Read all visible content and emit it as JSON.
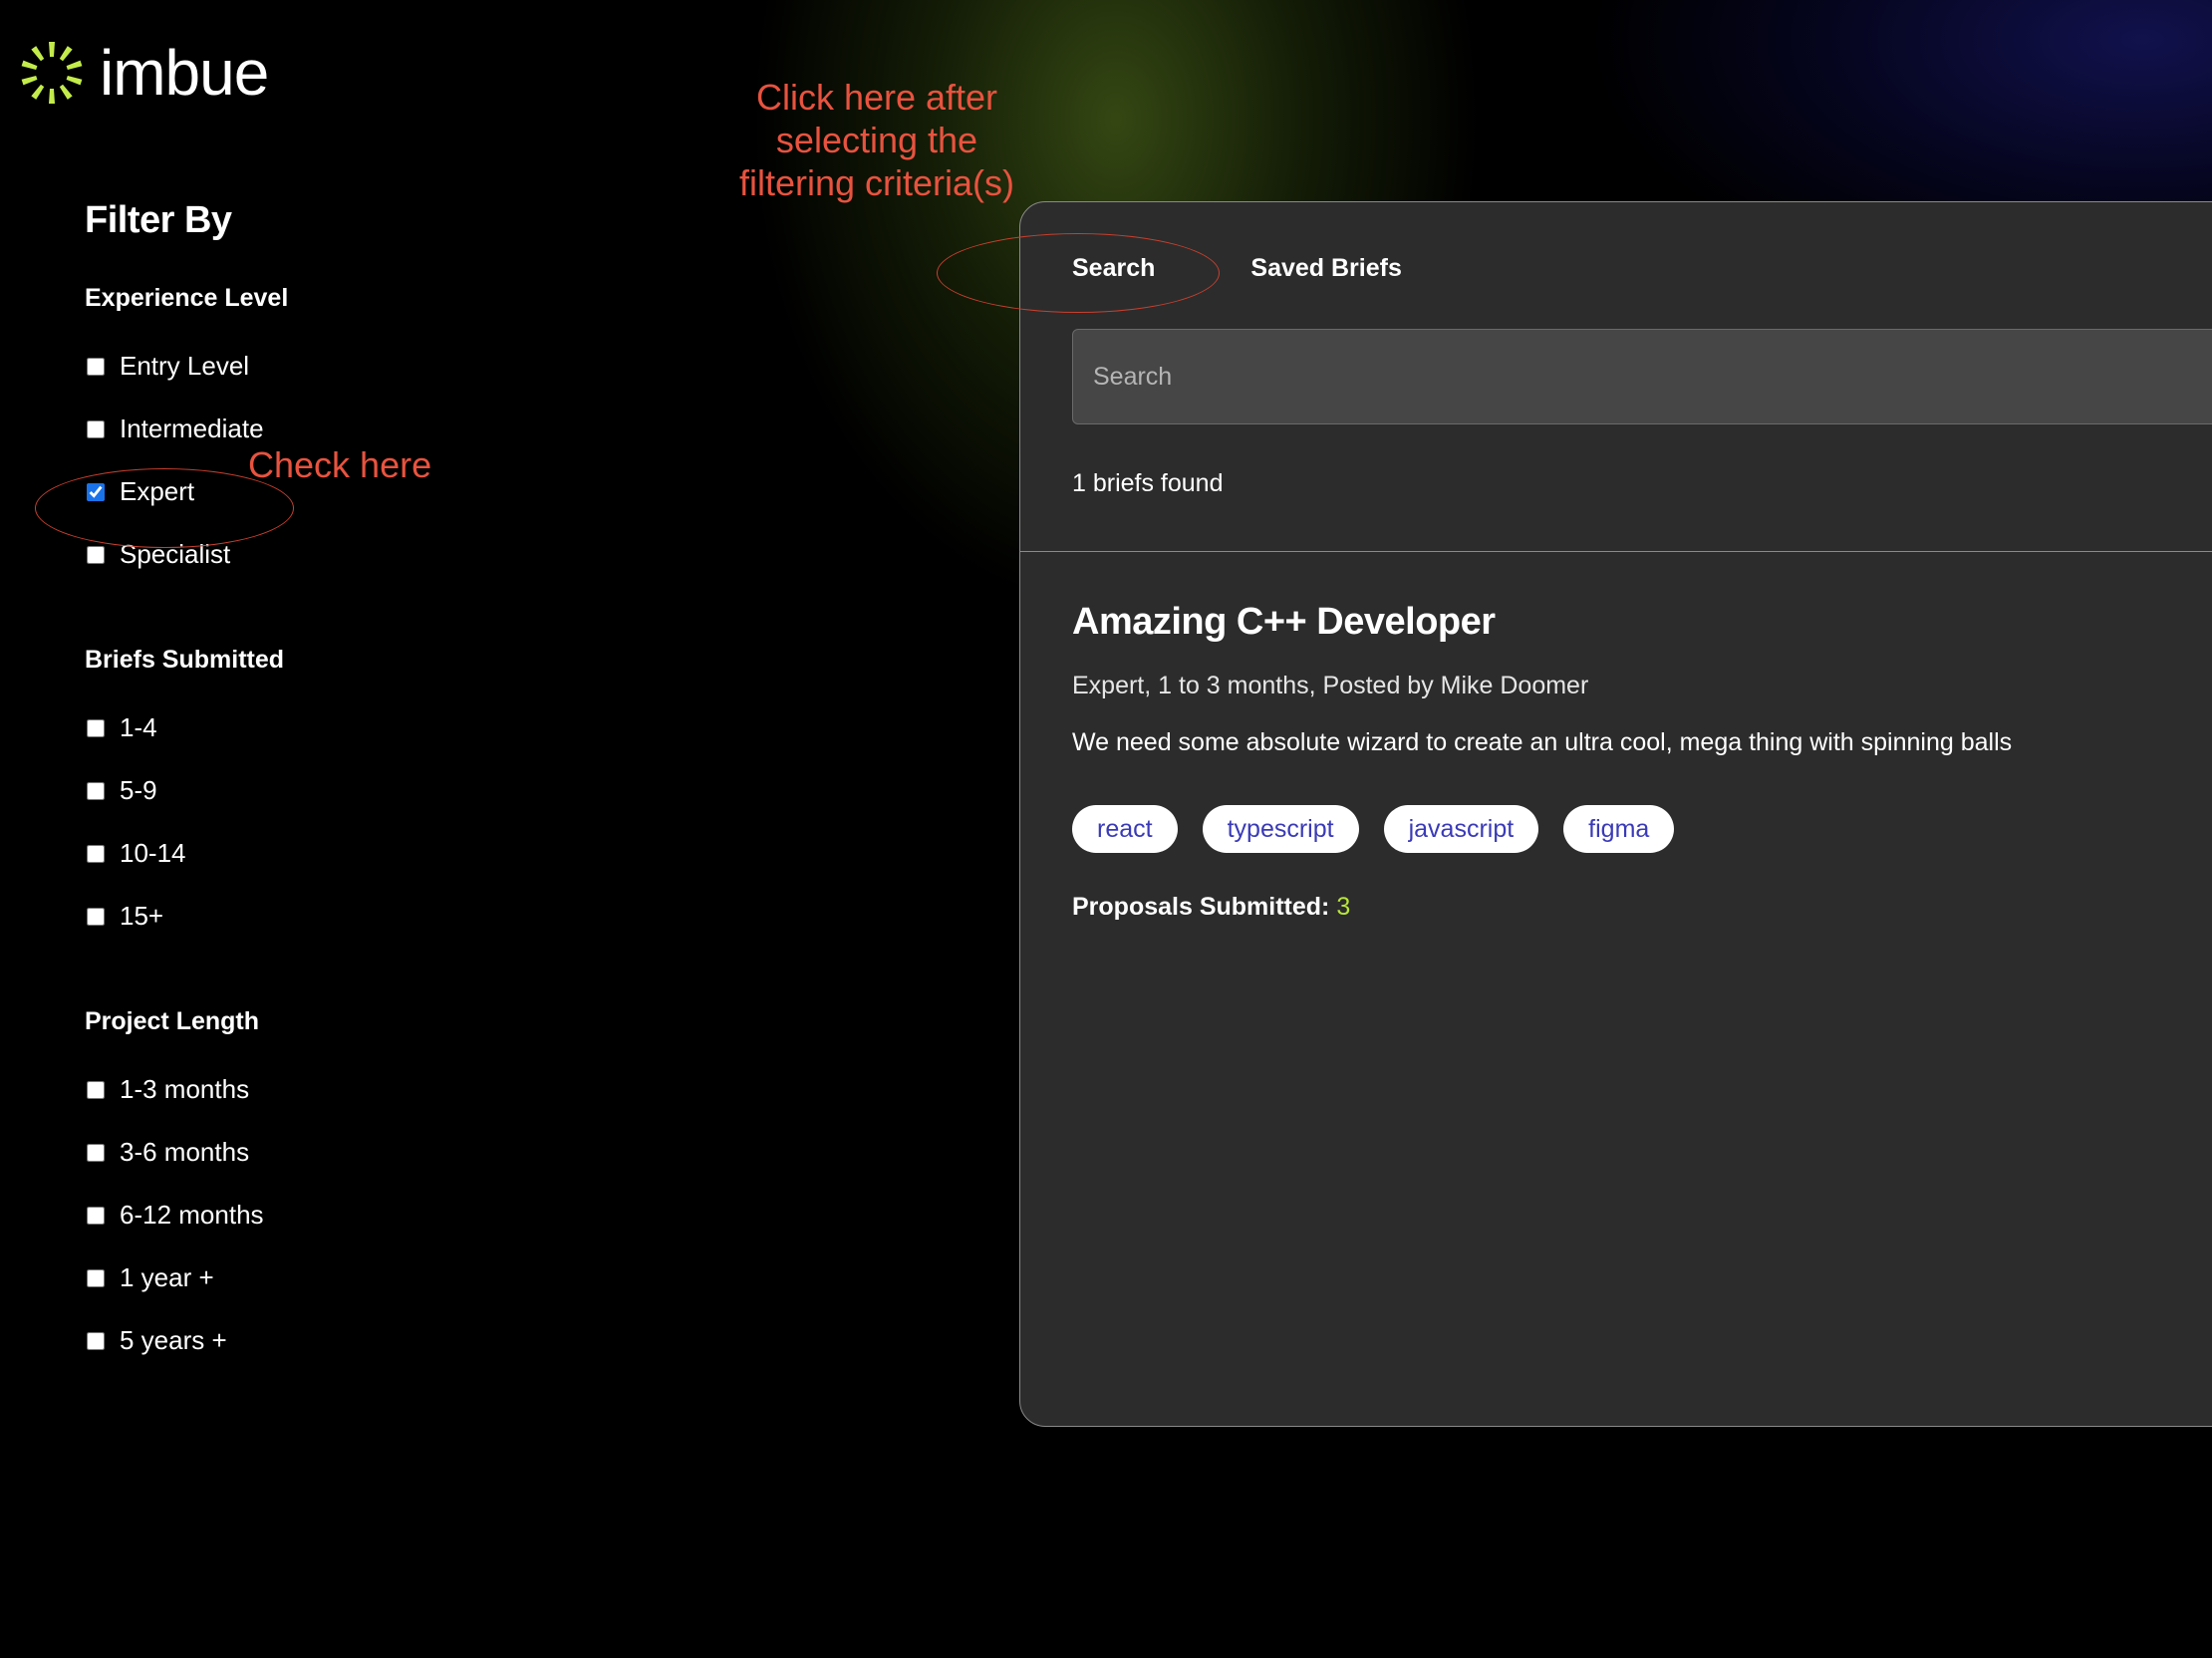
{
  "logo": {
    "text": "imbue",
    "icon": "imbue-sunburst-icon",
    "accent": "#c3ec4b"
  },
  "annotations": {
    "search_hint": "Click here after selecting the filtering criteria(s)",
    "check_hint": "Check here",
    "color": "#e8533f"
  },
  "sidebar": {
    "title": "Filter By",
    "experience": {
      "title": "Experience Level",
      "options": [
        {
          "label": "Entry Level",
          "checked": false
        },
        {
          "label": "Intermediate",
          "checked": false
        },
        {
          "label": "Expert",
          "checked": true
        },
        {
          "label": "Specialist",
          "checked": false
        }
      ]
    },
    "briefs_submitted": {
      "title": "Briefs Submitted",
      "options": [
        {
          "label": "1-4",
          "checked": false
        },
        {
          "label": "5-9",
          "checked": false
        },
        {
          "label": "10-14",
          "checked": false
        },
        {
          "label": "15+",
          "checked": false
        }
      ]
    },
    "project_length": {
      "title": "Project Length",
      "options": [
        {
          "label": "1-3 months",
          "checked": false
        },
        {
          "label": "3-6 months",
          "checked": false
        },
        {
          "label": "6-12 months",
          "checked": false
        },
        {
          "label": "1 year +",
          "checked": false
        },
        {
          "label": "5 years +",
          "checked": false
        }
      ]
    }
  },
  "main": {
    "tabs": [
      {
        "label": "Search",
        "active": true
      },
      {
        "label": "Saved Briefs",
        "active": false
      }
    ],
    "search": {
      "placeholder": "Search",
      "value": ""
    },
    "results_count": "1 briefs found",
    "brief": {
      "title": "Amazing C++ Developer",
      "meta": "Expert, 1 to 3 months, Posted by Mike Doomer",
      "description": "We need some absolute wizard to create an ultra cool, mega thing with spinning balls",
      "tags": [
        "react",
        "typescript",
        "javascript",
        "figma"
      ],
      "proposals_label": "Proposals Submitted:",
      "proposals_count": "3"
    }
  },
  "colors": {
    "panel_bg": "#2c2c2c",
    "tag_text": "#3a3ab8",
    "proposals_count": "#b7e63a"
  }
}
